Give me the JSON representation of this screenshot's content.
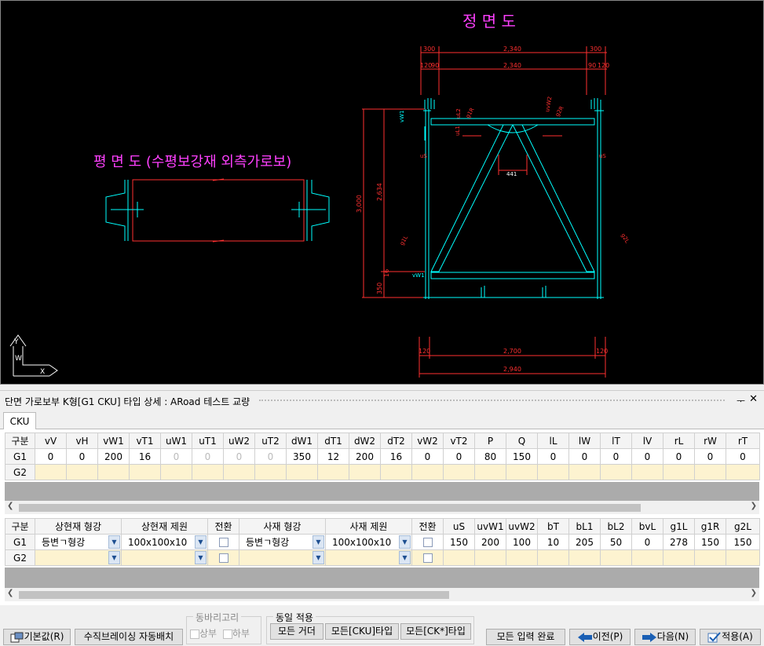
{
  "drawing": {
    "front_title": "정 면 도",
    "plan_title": "평 면 도 (수평보강재 외측가로보)",
    "dims_top": {
      "left": "300",
      "mid": "2,340",
      "right": "300"
    },
    "dims_top2": {
      "l1": "120",
      "l2": "90",
      "mid": "2,340",
      "r1": "90",
      "r2": "120"
    },
    "dims_left": {
      "total": "3,000",
      "inner": "2,634",
      "bottom": "350",
      "bottom2": "16"
    },
    "dims_bottom": {
      "left": "120",
      "mid": "2,700",
      "right": "120",
      "total": "2,940"
    },
    "labels": {
      "vW1_top": "vW1",
      "uL2": "uL2",
      "uL1": "uL1",
      "g1R": "g1R",
      "uvW2": "uvW2",
      "g2R": "g2R",
      "uS_l": "uS",
      "uS_r": "uS",
      "bw": "441",
      "g1L": "g1L",
      "g2L": "g2L",
      "vW1_bot": "vW1",
      "vW1_b2": "16"
    },
    "axis": {
      "y": "Y",
      "w": "W",
      "x": "X"
    }
  },
  "panel": {
    "title": "단면 가로보부 K형[G1 CKU] 타입 상세 : ARoad 테스트 교량",
    "pin": "ᅮ",
    "close": "✕"
  },
  "tab": "CKU",
  "table1": {
    "headers": [
      "구분",
      "vV",
      "vH",
      "vW1",
      "vT1",
      "uW1",
      "uT1",
      "uW2",
      "uT2",
      "dW1",
      "dT1",
      "dW2",
      "dT2",
      "vW2",
      "vT2",
      "P",
      "Q",
      "lL",
      "lW",
      "lT",
      "lV",
      "rL",
      "rW",
      "rT"
    ],
    "g1": [
      "G1",
      "0",
      "0",
      "200",
      "16",
      "0",
      "0",
      "0",
      "0",
      "350",
      "12",
      "200",
      "16",
      "0",
      "0",
      "80",
      "150",
      "0",
      "0",
      "0",
      "0",
      "0",
      "0",
      "0"
    ],
    "g2": [
      "G2"
    ]
  },
  "table2": {
    "headers": [
      "구분",
      "상현재 형강",
      "상현재 제원",
      "전환",
      "사재 형강",
      "사재 제원",
      "전환",
      "uS",
      "uvW1",
      "uvW2",
      "bT",
      "bL1",
      "bL2",
      "bvL",
      "g1L",
      "g1R",
      "g2L"
    ],
    "g1": [
      "G1",
      "등변ㄱ형강",
      "100x100x10",
      "",
      "등변ㄱ형강",
      "100x100x10",
      "",
      "150",
      "200",
      "100",
      "10",
      "205",
      "50",
      "0",
      "278",
      "150",
      "150"
    ],
    "g2": [
      "G2"
    ]
  },
  "buttons": {
    "default": "기본값(R)",
    "auto_brace": "수직브레이싱 자동배치",
    "group_ring": "동바리고리",
    "upper": "상부",
    "lower": "하부",
    "group_same": "동일 적용",
    "all_girders": "모든 거더",
    "all_cku": "모든[CKU]타입",
    "all_ck": "모든[CK*]타입",
    "complete": "모든 입력 완료",
    "prev": "이전(P)",
    "next": "다음(N)",
    "apply": "적용(A)"
  },
  "colors": {
    "cyan": "#00ffff",
    "red": "#ff3030",
    "magenta": "#ff40ff",
    "white": "#ffffff",
    "yellow": "#ffff00"
  }
}
